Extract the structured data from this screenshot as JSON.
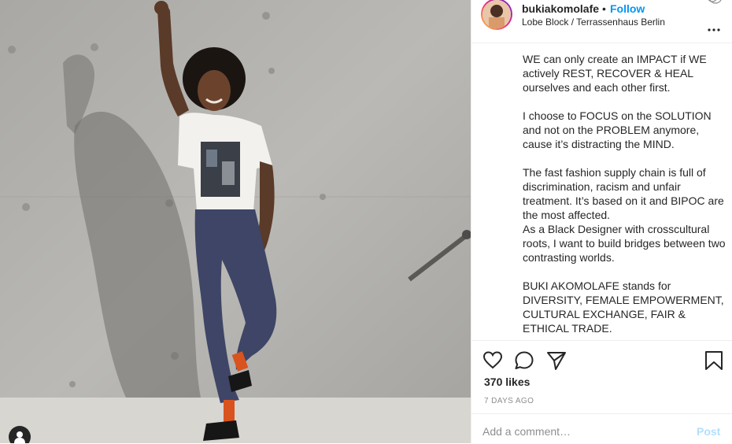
{
  "post": {
    "image_alt": "Woman with raised fist standing against a concrete wall",
    "tag_icon": "person-tag-icon"
  },
  "header": {
    "username": "bukiakomolafe",
    "separator": "•",
    "follow_label": "Follow",
    "location": "Lobe Block / Terrassenhaus Berlin",
    "more_icon": "more-options-icon"
  },
  "caption": {
    "paragraphs": [
      "WE can only create an IMPACT if WE actively REST, RECOVER & HEAL ourselves and each other first.",
      "I choose to FOCUS on the SOLUTION and not on the PROBLEM anymore, cause it’s distracting the MIND.",
      "The fast fashion supply chain is full of discrimination, racism and unfair treatment. It’s based on it and BIPOC are the most affected.\nAs a Black Designer with crosscultural roots, I want to build bridges between two contrasting worlds.",
      "BUKI AKOMOLAFE stands for DIVERSITY, FEMALE EMPOWERMENT, CULTURAL EXCHANGE, FAIR & ETHICAL TRADE."
    ]
  },
  "actions": {
    "icons": [
      "heart-icon",
      "comment-icon",
      "share-icon",
      "bookmark-icon"
    ],
    "likes": "370 likes",
    "age": "7 DAYS AGO"
  },
  "comment": {
    "placeholder": "Add a comment…",
    "post_label": "Post"
  },
  "colors": {
    "link_blue": "#0095f6",
    "post_disabled": "#b2dffc",
    "text": "#262626",
    "muted": "#8e8e8e",
    "divider": "#efefef"
  }
}
